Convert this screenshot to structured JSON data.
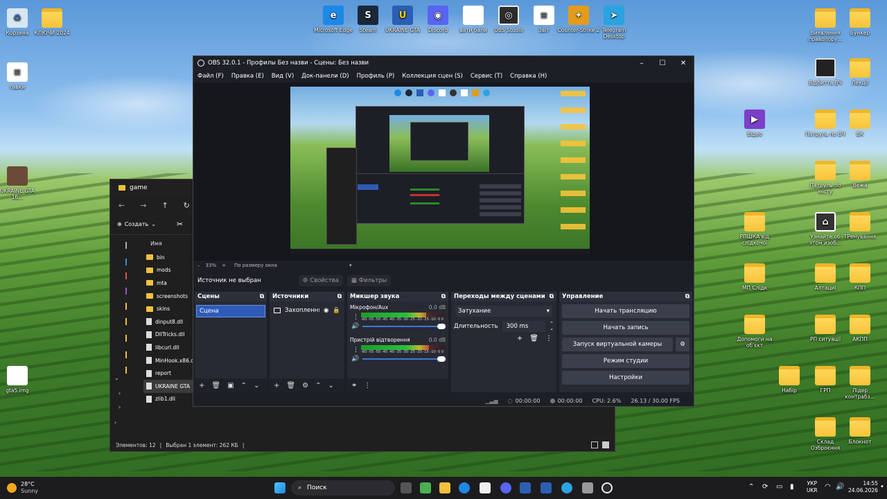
{
  "desktop": {
    "left_icons": [
      {
        "label": "Корзина",
        "icon": "recycle-bin-icon"
      },
      {
        "label": "КЛЮЧИ 2024",
        "icon": "folder-icon"
      },
      {
        "label": "гавки",
        "icon": "document-icon"
      },
      {
        "label": "UKRAINE GTA 16...",
        "icon": "game-icon"
      },
      {
        "label": "gta5.img",
        "icon": "document-icon"
      }
    ],
    "top_icons": [
      {
        "label": "Microsoft Edge",
        "icon": "edge-icon",
        "color": "#1e88e5"
      },
      {
        "label": "Steam",
        "icon": "steam-icon",
        "color": "#1b2838"
      },
      {
        "label": "UKRAINE GTA",
        "icon": "ukraine-gta-icon",
        "color": "#2b5fb4"
      },
      {
        "label": "Discord",
        "icon": "discord-icon",
        "color": "#5865f2"
      },
      {
        "label": "вати бали",
        "icon": "document-icon",
        "color": "#ffffff"
      },
      {
        "label": "OBS Studio",
        "icon": "obs-icon",
        "color": "#2d2d2d"
      },
      {
        "label": "Звіт",
        "icon": "document-icon",
        "color": "#ffffff"
      },
      {
        "label": "Counter-Strike 2",
        "icon": "cs2-icon",
        "color": "#e39b1b"
      },
      {
        "label": "Telegram Desktop",
        "icon": "telegram-icon",
        "color": "#2aa3df"
      }
    ],
    "right_icons": [
      {
        "label": "Виявлення правопору...",
        "icon": "folder-icon"
      },
      {
        "label": "Бункер",
        "icon": "folder-icon"
      },
      {
        "label": "Відбитта ВЧ",
        "icon": "folder-icon"
      },
      {
        "label": "Лекції",
        "icon": "folder-icon"
      },
      {
        "label": "Відео",
        "icon": "video-icon"
      },
      {
        "label": "Патруль по ВЧ",
        "icon": "folder-icon"
      },
      {
        "label": "ВК",
        "icon": "folder-icon"
      },
      {
        "label": "Патруль по місту",
        "icon": "folder-icon"
      },
      {
        "label": "Вежа",
        "icon": "folder-icon"
      },
      {
        "label": "РПШКА від слідкочої",
        "icon": "folder-icon"
      },
      {
        "label": "Узнайте об этом изоб...",
        "icon": "info-icon"
      },
      {
        "label": "ТРенування",
        "icon": "folder-icon"
      },
      {
        "label": "МП Слідк",
        "icon": "folder-icon"
      },
      {
        "label": "Алтациї",
        "icon": "folder-icon"
      },
      {
        "label": "КПП",
        "icon": "folder-icon"
      },
      {
        "label": "Допомоги на об'єкт",
        "icon": "folder-icon"
      },
      {
        "label": "РП ситуації",
        "icon": "folder-icon"
      },
      {
        "label": "АКПП",
        "icon": "folder-icon"
      },
      {
        "label": "Набір",
        "icon": "folder-icon"
      },
      {
        "label": "ГРП",
        "icon": "folder-icon"
      },
      {
        "label": "Лідер контрабз...",
        "icon": "folder-icon"
      },
      {
        "label": "Склад Озброєння",
        "icon": "folder-icon"
      },
      {
        "label": "Блокнот",
        "icon": "folder-icon"
      }
    ]
  },
  "explorer": {
    "title": "game",
    "toolbar": {
      "create_label": "Создать"
    },
    "column_name": "Имя",
    "items": [
      {
        "name": "bin",
        "type": "folder"
      },
      {
        "name": "mods",
        "type": "folder"
      },
      {
        "name": "mta",
        "type": "folder"
      },
      {
        "name": "screenshots",
        "type": "folder"
      },
      {
        "name": "skins",
        "type": "folder"
      },
      {
        "name": "dinput8.dll",
        "type": "file"
      },
      {
        "name": "DllTricks.dll",
        "type": "file"
      },
      {
        "name": "libcurl.dll",
        "type": "file"
      },
      {
        "name": "MinHook.x86.dll",
        "type": "file"
      },
      {
        "name": "report",
        "type": "file"
      },
      {
        "name": "UKRAINE GTA",
        "type": "file"
      },
      {
        "name": "zlib1.dll",
        "type": "file"
      }
    ],
    "status": {
      "count": "Элементов: 12",
      "selected": "Выбран 1 элемент: 262 КБ"
    }
  },
  "obs": {
    "title": "OBS 32.0.1 - Профилы Без назви - Сцены: Без назви",
    "menu": [
      "Файл (F)",
      "Правка (E)",
      "Вид (V)",
      "Док-панели (D)",
      "Профиль (P)",
      "Коллекция сцен (S)",
      "Сервис (T)",
      "Справка (H)"
    ],
    "zoom": {
      "level": "33%",
      "fit": "По размеру окна"
    },
    "source_bar": {
      "none_selected": "Источник не выбран",
      "properties": "Свойства",
      "filters": "Фильтры"
    },
    "scenes": {
      "title": "Сцены",
      "items": [
        "Сцена"
      ]
    },
    "sources": {
      "title": "Источники",
      "items": [
        "Захоплення"
      ]
    },
    "mixer": {
      "title": "Микшер звука",
      "channels": [
        {
          "name": "Мікрофон/Aux",
          "db": "0.0 dB",
          "level": 0.78
        },
        {
          "name": "Пристрій відтворення",
          "db": "0.0 dB",
          "level": 0.82
        }
      ],
      "ticks": "-60 -55 -50 -45 -40 -35 -30 -25 -20 -15 -10 -5 0"
    },
    "transitions": {
      "title": "Переходы между сценами",
      "type": "Затухание",
      "duration_label": "Длительность",
      "duration_value": "300 ms"
    },
    "controls": {
      "title": "Управление",
      "start_stream": "Начать трансляцию",
      "start_record": "Начать запись",
      "virtual_cam": "Запуск виртуальной камеры",
      "studio_mode": "Режим студии",
      "settings": "Настройки"
    },
    "status": {
      "stream_time": "00:00:00",
      "rec_time": "00:00:00",
      "cpu": "CPU: 2.6%",
      "fps": "26.13 / 30.00 FPS"
    }
  },
  "taskbar": {
    "weather_temp": "28°C",
    "weather_desc": "Sunny",
    "search_placeholder": "Поиск",
    "lang_top": "УКР",
    "lang_bottom": "UKR",
    "time": "14:55",
    "date": "24.06.2026"
  }
}
